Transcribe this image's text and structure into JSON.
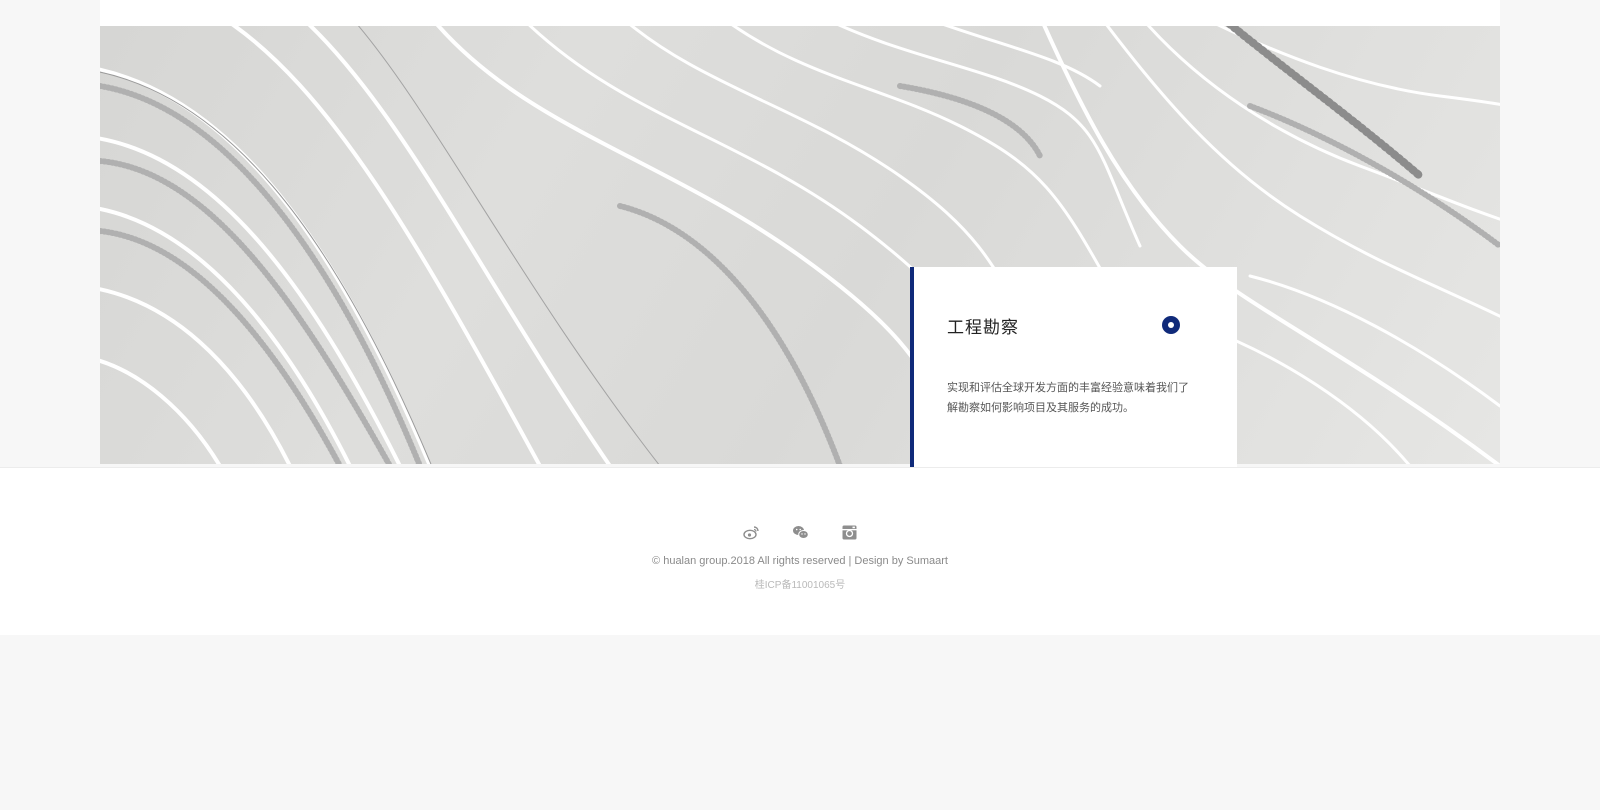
{
  "card": {
    "title": "工程勘察",
    "description": "实现和评估全球开发方面的丰富经验意味着我们了解勘察如何影响项目及其服务的成功。",
    "accent_color": "#102a7a"
  },
  "footer": {
    "socials": [
      {
        "icon": "weibo-icon"
      },
      {
        "icon": "wechat-icon"
      },
      {
        "icon": "instagram-icon"
      }
    ],
    "copyright": "© hualan group.2018 All rights reserved | Design by Sumaart",
    "icp": "桂ICP备11001065号"
  }
}
